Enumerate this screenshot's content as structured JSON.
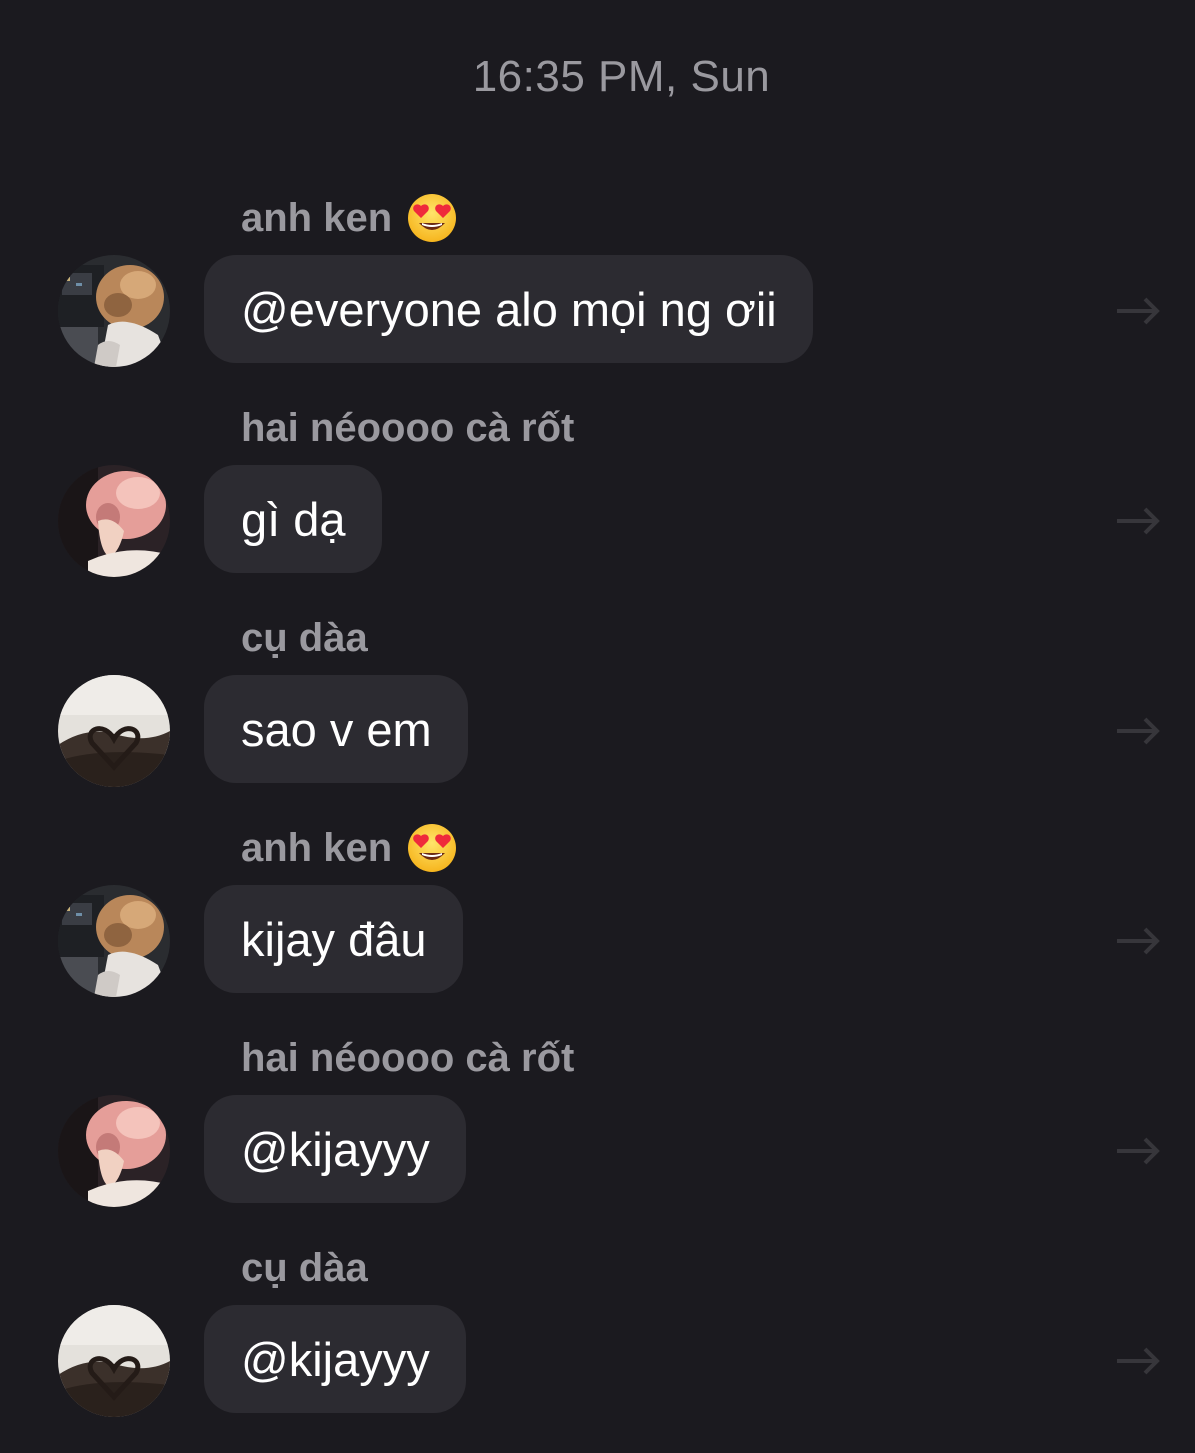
{
  "timestamp": "16:35 PM, Sun",
  "messages": [
    {
      "sender": "anh ken",
      "sender_emoji": "smiling-face-heart-eyes",
      "avatar": "avatar-anh-ken",
      "text": "@everyone alo mọi ng ơii"
    },
    {
      "sender": "hai néoooo cà rốt",
      "sender_emoji": null,
      "avatar": "avatar-hai-neoooo",
      "text": "gì dạ"
    },
    {
      "sender": "cụ dàa",
      "sender_emoji": null,
      "avatar": "avatar-cu-daa",
      "text": "sao v em"
    },
    {
      "sender": "anh ken",
      "sender_emoji": "smiling-face-heart-eyes",
      "avatar": "avatar-anh-ken",
      "text": "kijay đâu"
    },
    {
      "sender": "hai néoooo cà rốt",
      "sender_emoji": null,
      "avatar": "avatar-hai-neoooo",
      "text": "@kijayyy"
    },
    {
      "sender": "cụ dàa",
      "sender_emoji": null,
      "avatar": "avatar-cu-daa",
      "text": "@kijayyy"
    }
  ],
  "colors": {
    "background": "#1b1a1f",
    "bubble": "#2c2b31",
    "secondary_text": "#9a999f",
    "message_text": "#ffffff"
  }
}
